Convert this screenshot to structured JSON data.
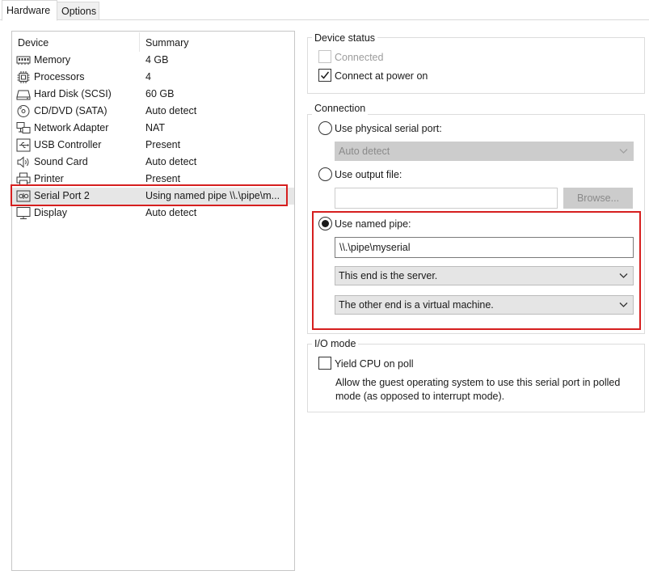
{
  "tabs": [
    {
      "label": "Hardware"
    },
    {
      "label": "Options"
    }
  ],
  "device_list": {
    "columns": {
      "device": "Device",
      "summary": "Summary"
    },
    "rows": [
      {
        "name": "Memory",
        "summary": "4 GB",
        "icon": "memory-icon"
      },
      {
        "name": "Processors",
        "summary": "4",
        "icon": "processor-icon"
      },
      {
        "name": "Hard Disk (SCSI)",
        "summary": "60 GB",
        "icon": "hard-disk-icon"
      },
      {
        "name": "CD/DVD (SATA)",
        "summary": "Auto detect",
        "icon": "cd-dvd-icon"
      },
      {
        "name": "Network Adapter",
        "summary": "NAT",
        "icon": "network-adapter-icon"
      },
      {
        "name": "USB Controller",
        "summary": "Present",
        "icon": "usb-icon"
      },
      {
        "name": "Sound Card",
        "summary": "Auto detect",
        "icon": "speaker-icon"
      },
      {
        "name": "Printer",
        "summary": "Present",
        "icon": "printer-icon"
      },
      {
        "name": "Serial Port 2",
        "summary": "Using named pipe \\\\.\\pipe\\m...",
        "icon": "serial-port-icon",
        "selected": true
      },
      {
        "name": "Display",
        "summary": "Auto detect",
        "icon": "display-icon"
      }
    ]
  },
  "device_status": {
    "title": "Device status",
    "connected": {
      "label": "Connected",
      "checked": false,
      "enabled": false
    },
    "connect_at_power_on": {
      "label": "Connect at power on",
      "checked": true
    }
  },
  "connection": {
    "title": "Connection",
    "physical_port": {
      "label": "Use physical serial port:",
      "selected": false,
      "value": "Auto detect"
    },
    "output_file": {
      "label": "Use output file:",
      "selected": false,
      "value": "",
      "browse_label": "Browse..."
    },
    "named_pipe": {
      "label": "Use named pipe:",
      "selected": true,
      "pipe_name": "\\\\.\\pipe\\myserial",
      "end_role": "This end is the server.",
      "other_end": "The other end is a virtual machine."
    }
  },
  "io_mode": {
    "title": "I/O mode",
    "yield_cpu": {
      "label": "Yield CPU on poll",
      "checked": false
    },
    "description": "Allow the guest operating system to use this serial port in polled mode (as opposed to interrupt mode)."
  },
  "colors": {
    "highlight_border": "#d61f1f",
    "selected_row": "#e6e6e6",
    "disabled_control": "#cccccc"
  }
}
